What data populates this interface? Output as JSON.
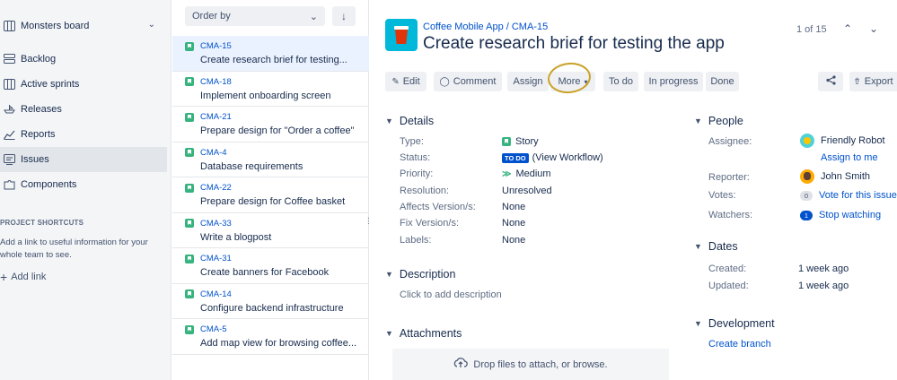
{
  "sidebar": {
    "board_name": "Monsters board",
    "items": [
      {
        "label": "Backlog",
        "icon": "backlog-icon"
      },
      {
        "label": "Active sprints",
        "icon": "sprint-icon"
      },
      {
        "label": "Releases",
        "icon": "ship-icon"
      },
      {
        "label": "Reports",
        "icon": "chart-icon"
      },
      {
        "label": "Issues",
        "icon": "issues-icon",
        "active": true
      },
      {
        "label": "Components",
        "icon": "puzzle-icon"
      }
    ],
    "shortcuts_title": "PROJECT SHORTCUTS",
    "shortcuts_desc": "Add a link to useful information for your whole team to see.",
    "add_link": "Add link"
  },
  "list": {
    "order_by": "Order by",
    "issues": [
      {
        "key": "CMA-15",
        "summary": "Create research brief for testing...",
        "selected": true
      },
      {
        "key": "CMA-18",
        "summary": "Implement onboarding screen"
      },
      {
        "key": "CMA-21",
        "summary": "Prepare design for \"Order a coffee\""
      },
      {
        "key": "CMA-4",
        "summary": "Database requirements"
      },
      {
        "key": "CMA-22",
        "summary": "Prepare design for Coffee basket"
      },
      {
        "key": "CMA-33",
        "summary": "Write a blogpost"
      },
      {
        "key": "CMA-31",
        "summary": "Create banners for Facebook"
      },
      {
        "key": "CMA-14",
        "summary": "Configure backend infrastructure"
      },
      {
        "key": "CMA-5",
        "summary": "Add map view for browsing coffee..."
      }
    ]
  },
  "detail": {
    "breadcrumb": "Coffee Mobile App / CMA-15",
    "title": "Create research brief for testing the app",
    "pager": "1 of 15",
    "toolbar": {
      "edit": "Edit",
      "comment": "Comment",
      "assign": "Assign",
      "more": "More",
      "todo": "To do",
      "in_progress": "In progress",
      "done": "Done",
      "export": "Export"
    },
    "details": {
      "title": "Details",
      "type_label": "Type:",
      "type_value": "Story",
      "status_label": "Status:",
      "status_lozenge": "TO DO",
      "status_link": "(View Workflow)",
      "priority_label": "Priority:",
      "priority_value": "Medium",
      "resolution_label": "Resolution:",
      "resolution_value": "Unresolved",
      "affects_label": "Affects Version/s:",
      "affects_value": "None",
      "fix_label": "Fix Version/s:",
      "fix_value": "None",
      "labels_label": "Labels:",
      "labels_value": "None"
    },
    "description": {
      "title": "Description",
      "placeholder": "Click to add description"
    },
    "attachments": {
      "title": "Attachments",
      "drop_text": "Drop files to attach, or browse."
    },
    "people": {
      "title": "People",
      "assignee_label": "Assignee:",
      "assignee_value": "Friendly Robot",
      "assign_to_me": "Assign to me",
      "reporter_label": "Reporter:",
      "reporter_value": "John Smith",
      "votes_label": "Votes:",
      "votes_count": "0",
      "votes_link": "Vote for this issue",
      "watchers_label": "Watchers:",
      "watchers_count": "1",
      "watchers_link": "Stop watching"
    },
    "dates": {
      "title": "Dates",
      "created_label": "Created:",
      "created_value": "1 week ago",
      "updated_label": "Updated:",
      "updated_value": "1 week ago"
    },
    "development": {
      "title": "Development",
      "create_branch": "Create branch"
    }
  }
}
